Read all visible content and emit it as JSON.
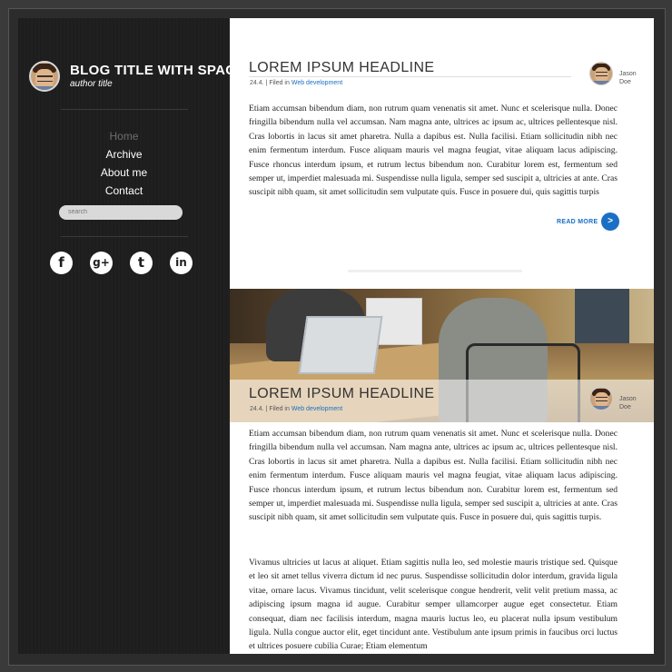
{
  "sidebar": {
    "blog_title": "BLOG TITLE WITH SPACE",
    "author_title": "author title",
    "nav": [
      "Home",
      "Archive",
      "About me",
      "Contact"
    ],
    "search_placeholder": "search",
    "socials": [
      {
        "icon": "facebook-icon",
        "glyph": "f"
      },
      {
        "icon": "google-plus-icon",
        "glyph": "g+"
      },
      {
        "icon": "twitter-icon",
        "glyph": "t"
      },
      {
        "icon": "linkedin-icon",
        "glyph": "in"
      }
    ]
  },
  "posts": [
    {
      "headline": "LOREM IPSUM HEADLINE",
      "date": "24.4.",
      "separator": "|",
      "filed_in": "Filed in",
      "category": "Web development",
      "author_first": "Jason",
      "author_last": "Doe",
      "body": "Etiam accumsan bibendum diam, non rutrum quam venenatis sit amet. Nunc et scelerisque nulla. Donec fringilla bibendum nulla vel accumsan. Nam magna ante, ultrices ac ipsum ac, ultrices pellentesque nisl. Cras lobortis in lacus sit amet pharetra. Nulla a dapibus est. Nulla facilisi. Etiam sollicitudin nibh nec enim fermentum interdum. Fusce aliquam mauris vel magna feugiat, vitae aliquam lacus adipiscing. Fusce rhoncus interdum ipsum, et rutrum lectus bibendum non. Curabitur lorem est, fermentum sed semper ut, imperdiet malesuada mi. Suspendisse nulla ligula, semper sed suscipit a, ultricies at ante. Cras suscipit nibh quam, sit amet sollicitudin sem vulputate quis. Fusce in posuere dui, quis sagittis turpis",
      "read_more": "READ MORE",
      "read_more_glyph": ">"
    },
    {
      "headline": "LOREM IPSUM HEADLINE",
      "date": "24.4.",
      "separator": "|",
      "filed_in": "Filed in",
      "category": "Web development",
      "author_first": "Jason",
      "author_last": "Doe",
      "body": "Etiam accumsan bibendum diam, non rutrum quam venenatis sit amet. Nunc et scelerisque nulla. Donec fringilla bibendum nulla vel accumsan. Nam magna ante, ultrices ac ipsum ac, ultrices pellentesque nisl. Cras lobortis in lacus sit amet pharetra. Nulla a dapibus est. Nulla facilisi. Etiam sollicitudin nibh nec enim fermentum interdum. Fusce aliquam mauris vel magna feugiat, vitae aliquam lacus adipiscing. Fusce rhoncus interdum ipsum, et rutrum lectus bibendum non. Curabitur lorem est, fermentum sed semper ut, imperdiet malesuada mi. Suspendisse nulla ligula, semper sed suscipit a, ultricies at ante. Cras suscipit nibh quam, sit amet sollicitudin sem vulputate quis. Fusce in posuere dui, quis sagittis turpis.",
      "body2": "Vivamus ultricies ut lacus at aliquet. Etiam sagittis nulla leo, sed molestie mauris tristique sed. Quisque et leo sit amet tellus viverra dictum id nec purus. Suspendisse sollicitudin dolor interdum, gravida ligula vitae, ornare lacus. Vivamus tincidunt, velit scelerisque congue hendrerit, velit velit pretium massa, ac adipiscing ipsum magna id augue. Curabitur semper ullamcorper augue eget consectetur. Etiam consequat, diam nec facilisis interdum, magna mauris luctus leo, eu placerat nulla ipsum vestibulum ligula. Nulla congue auctor elit, eget tincidunt ante. Vestibulum ante ipsum primis in faucibus orci luctus et ultrices posuere cubilia Curae; Etiam elementum"
    }
  ],
  "colors": {
    "sidebar_bg": "#1e1e1e",
    "accent": "#1a6fc4",
    "page_bg": "#3a3a3a"
  }
}
